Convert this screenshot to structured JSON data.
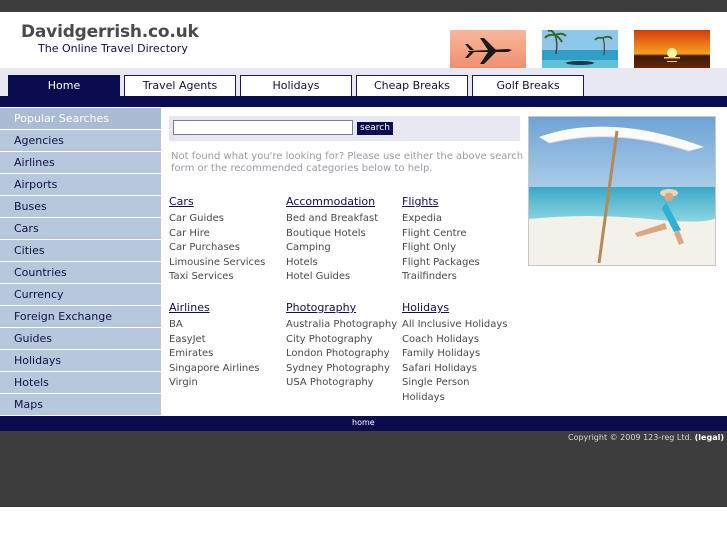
{
  "header": {
    "site_name": "Davidgerrish.co.uk",
    "tagline": "The Online Travel Directory"
  },
  "nav": {
    "tabs": [
      "Home",
      "Travel Agents",
      "Holidays",
      "Cheap Breaks",
      "Golf Breaks"
    ],
    "active": "Home"
  },
  "sidebar": {
    "heading": "Popular Searches",
    "items": [
      "Agencies",
      "Airlines",
      "Airports",
      "Buses",
      "Cars",
      "Cities",
      "Countries",
      "Currency",
      "Foreign Exchange",
      "Guides",
      "Holidays",
      "Hotels",
      "Maps"
    ]
  },
  "search": {
    "value": "",
    "button_label": "search",
    "notfound_text": "Not found what you're looking for? Please use either the above search form or the recommended categories below to help."
  },
  "categories": [
    {
      "title": "Cars",
      "links": [
        "Car Guides",
        "Car Hire",
        "Car Purchases",
        "Limousine Services",
        "Taxi Services"
      ]
    },
    {
      "title": "Accommodation",
      "links": [
        "Bed and Breakfast",
        "Boutique Hotels",
        "Camping",
        "Hotels",
        "Hotel Guides"
      ]
    },
    {
      "title": "Flights",
      "links": [
        "Expedia",
        "Flight Centre",
        "Flight Only",
        "Flight Packages",
        "Trailfinders"
      ]
    },
    {
      "title": "Airlines",
      "links": [
        "BA",
        "EasyJet",
        "Emirates",
        "Singapore Airlines",
        "Virgin"
      ]
    },
    {
      "title": "Photography",
      "links": [
        "Australia Photography",
        "City Photography",
        "London Photography",
        "Sydney Photography",
        "USA Photography"
      ]
    },
    {
      "title": "Holidays",
      "links": [
        "All Inclusive Holidays",
        "Coach Holidays",
        "Family Holidays",
        "Safari Holidays",
        "Single Person Holidays"
      ]
    }
  ],
  "footer": {
    "home_link": "home",
    "copyright": "Copyright © 2009 123-reg Ltd.",
    "legal": "(legal)"
  },
  "colors": {
    "navy": "#0b0b50",
    "sidebar": "#b8c8dc",
    "dark_bar": "#3d3d3d"
  },
  "icons": [
    "airplane-photo",
    "tropical-island-photo",
    "sunset-photo",
    "beach-umbrella-photo"
  ]
}
